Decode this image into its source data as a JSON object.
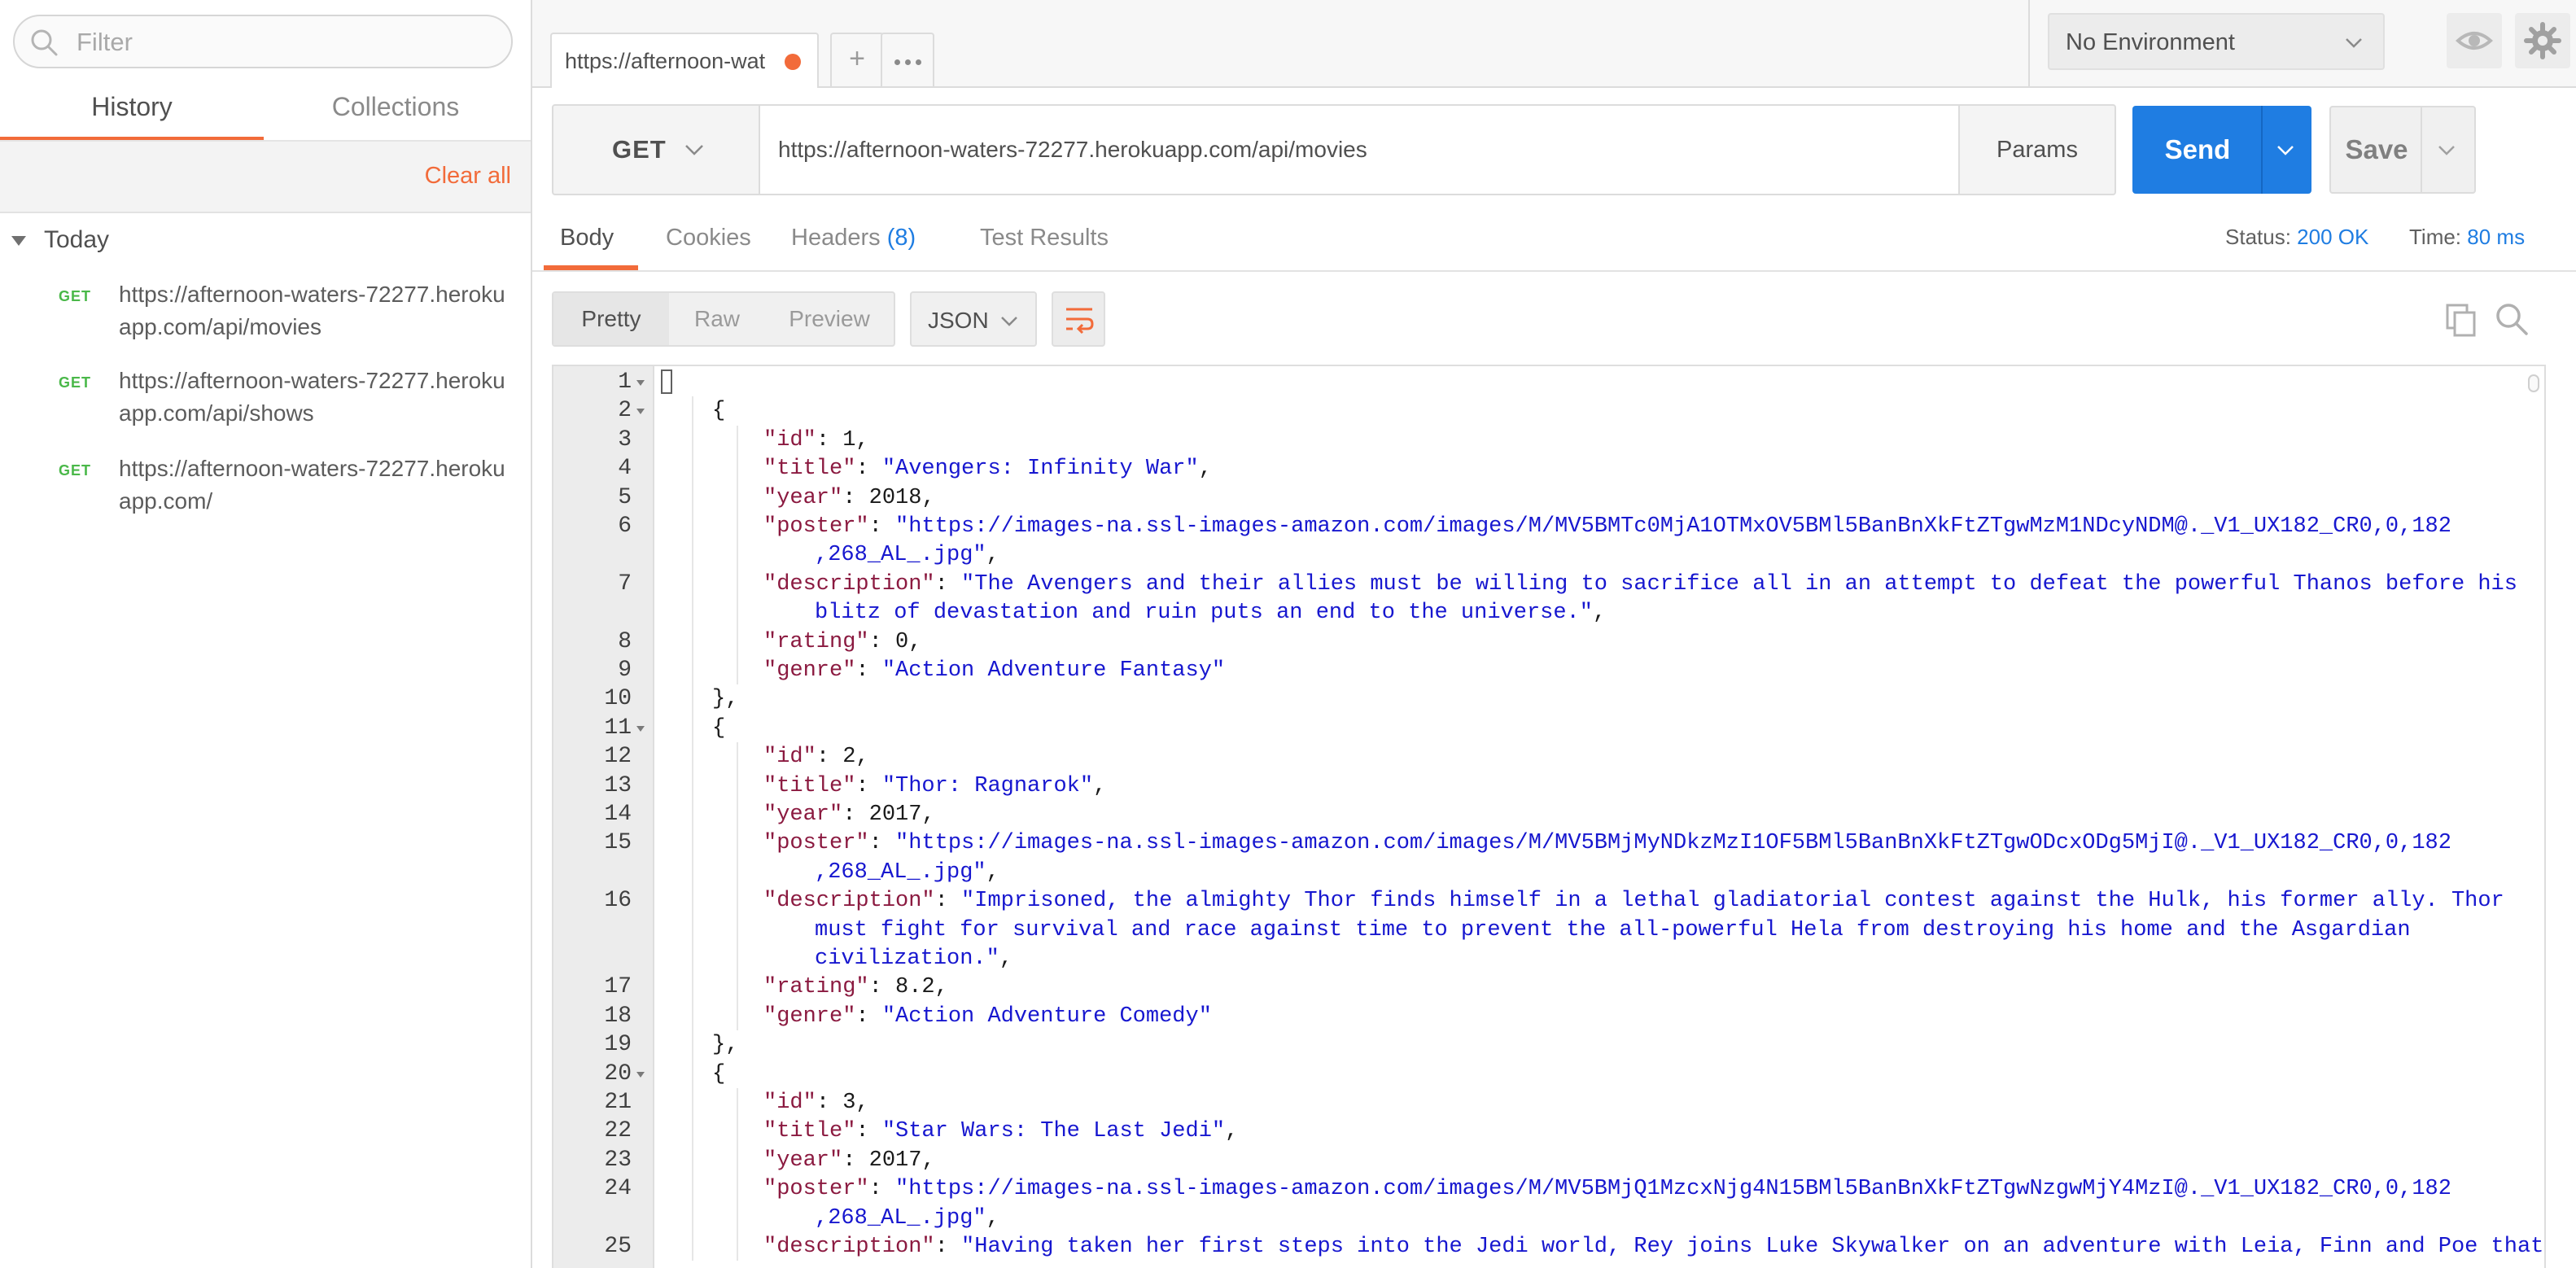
{
  "sidebar": {
    "filter_placeholder": "Filter",
    "tabs": [
      "History",
      "Collections"
    ],
    "clear_all": "Clear all",
    "group": "Today",
    "history": [
      {
        "method": "GET",
        "url": "https://afternoon-waters-72277.herokuapp.com/api/movies"
      },
      {
        "method": "GET",
        "url": "https://afternoon-waters-72277.herokuapp.com/api/shows"
      },
      {
        "method": "GET",
        "url": "https://afternoon-waters-72277.herokuapp.com/"
      }
    ]
  },
  "tabbar": {
    "active_tab": "https://afternoon-wat",
    "environment": "No Environment"
  },
  "request": {
    "method": "GET",
    "url": "https://afternoon-waters-72277.herokuapp.com/api/movies",
    "params_label": "Params",
    "send_label": "Send",
    "save_label": "Save"
  },
  "response": {
    "tabs": {
      "body": "Body",
      "cookies": "Cookies",
      "headers": "Headers",
      "headers_count": "(8)",
      "tests": "Test Results"
    },
    "status_label": "Status:",
    "status_value": "200 OK",
    "time_label": "Time:",
    "time_value": "80 ms",
    "views": [
      "Pretty",
      "Raw",
      "Preview"
    ],
    "format": "JSON"
  },
  "code": [
    {
      "n": "1",
      "fold": true,
      "indent": 0,
      "parts": [
        [
          "p",
          "["
        ]
      ]
    },
    {
      "n": "2",
      "fold": true,
      "indent": 1,
      "parts": [
        [
          "p",
          "{"
        ]
      ]
    },
    {
      "n": "3",
      "indent": 2,
      "parts": [
        [
          "k",
          "\"id\""
        ],
        [
          "p",
          ": "
        ],
        [
          "n",
          "1"
        ],
        [
          "p",
          ","
        ]
      ]
    },
    {
      "n": "4",
      "indent": 2,
      "parts": [
        [
          "k",
          "\"title\""
        ],
        [
          "p",
          ": "
        ],
        [
          "s",
          "\"Avengers: Infinity War\""
        ],
        [
          "p",
          ","
        ]
      ]
    },
    {
      "n": "5",
      "indent": 2,
      "parts": [
        [
          "k",
          "\"year\""
        ],
        [
          "p",
          ": "
        ],
        [
          "n",
          "2018"
        ],
        [
          "p",
          ","
        ]
      ]
    },
    {
      "n": "6",
      "indent": 2,
      "parts": [
        [
          "k",
          "\"poster\""
        ],
        [
          "p",
          ": "
        ],
        [
          "s",
          "\"https://images-na.ssl-images-amazon.com/images/M/MV5BMTc0MjA1OTMxOV5BMl5BanBnXkFtZTgwMzM1NDcyNDM@._V1_UX182_CR0,0,182"
        ]
      ]
    },
    {
      "n": "",
      "indent": 3,
      "parts": [
        [
          "s",
          ",268_AL_.jpg\""
        ],
        [
          "p",
          ","
        ]
      ]
    },
    {
      "n": "7",
      "indent": 2,
      "parts": [
        [
          "k",
          "\"description\""
        ],
        [
          "p",
          ": "
        ],
        [
          "s",
          "\"The Avengers and their allies must be willing to sacrifice all in an attempt to defeat the powerful Thanos before his"
        ]
      ]
    },
    {
      "n": "",
      "indent": 3,
      "parts": [
        [
          "s",
          "blitz of devastation and ruin puts an end to the universe.\""
        ],
        [
          "p",
          ","
        ]
      ]
    },
    {
      "n": "8",
      "indent": 2,
      "parts": [
        [
          "k",
          "\"rating\""
        ],
        [
          "p",
          ": "
        ],
        [
          "n",
          "0"
        ],
        [
          "p",
          ","
        ]
      ]
    },
    {
      "n": "9",
      "indent": 2,
      "parts": [
        [
          "k",
          "\"genre\""
        ],
        [
          "p",
          ": "
        ],
        [
          "s",
          "\"Action Adventure Fantasy\""
        ]
      ]
    },
    {
      "n": "10",
      "indent": 1,
      "parts": [
        [
          "p",
          "},"
        ]
      ]
    },
    {
      "n": "11",
      "fold": true,
      "indent": 1,
      "parts": [
        [
          "p",
          "{"
        ]
      ]
    },
    {
      "n": "12",
      "indent": 2,
      "parts": [
        [
          "k",
          "\"id\""
        ],
        [
          "p",
          ": "
        ],
        [
          "n",
          "2"
        ],
        [
          "p",
          ","
        ]
      ]
    },
    {
      "n": "13",
      "indent": 2,
      "parts": [
        [
          "k",
          "\"title\""
        ],
        [
          "p",
          ": "
        ],
        [
          "s",
          "\"Thor: Ragnarok\""
        ],
        [
          "p",
          ","
        ]
      ]
    },
    {
      "n": "14",
      "indent": 2,
      "parts": [
        [
          "k",
          "\"year\""
        ],
        [
          "p",
          ": "
        ],
        [
          "n",
          "2017"
        ],
        [
          "p",
          ","
        ]
      ]
    },
    {
      "n": "15",
      "indent": 2,
      "parts": [
        [
          "k",
          "\"poster\""
        ],
        [
          "p",
          ": "
        ],
        [
          "s",
          "\"https://images-na.ssl-images-amazon.com/images/M/MV5BMjMyNDkzMzI1OF5BMl5BanBnXkFtZTgwODcxODg5MjI@._V1_UX182_CR0,0,182"
        ]
      ]
    },
    {
      "n": "",
      "indent": 3,
      "parts": [
        [
          "s",
          ",268_AL_.jpg\""
        ],
        [
          "p",
          ","
        ]
      ]
    },
    {
      "n": "16",
      "indent": 2,
      "parts": [
        [
          "k",
          "\"description\""
        ],
        [
          "p",
          ": "
        ],
        [
          "s",
          "\"Imprisoned, the almighty Thor finds himself in a lethal gladiatorial contest against the Hulk, his former ally. Thor"
        ]
      ]
    },
    {
      "n": "",
      "indent": 3,
      "parts": [
        [
          "s",
          "must fight for survival and race against time to prevent the all-powerful Hela from destroying his home and the Asgardian"
        ]
      ]
    },
    {
      "n": "",
      "indent": 3,
      "parts": [
        [
          "s",
          "civilization.\""
        ],
        [
          "p",
          ","
        ]
      ]
    },
    {
      "n": "17",
      "indent": 2,
      "parts": [
        [
          "k",
          "\"rating\""
        ],
        [
          "p",
          ": "
        ],
        [
          "n",
          "8.2"
        ],
        [
          "p",
          ","
        ]
      ]
    },
    {
      "n": "18",
      "indent": 2,
      "parts": [
        [
          "k",
          "\"genre\""
        ],
        [
          "p",
          ": "
        ],
        [
          "s",
          "\"Action Adventure Comedy\""
        ]
      ]
    },
    {
      "n": "19",
      "indent": 1,
      "parts": [
        [
          "p",
          "},"
        ]
      ]
    },
    {
      "n": "20",
      "fold": true,
      "indent": 1,
      "parts": [
        [
          "p",
          "{"
        ]
      ]
    },
    {
      "n": "21",
      "indent": 2,
      "parts": [
        [
          "k",
          "\"id\""
        ],
        [
          "p",
          ": "
        ],
        [
          "n",
          "3"
        ],
        [
          "p",
          ","
        ]
      ]
    },
    {
      "n": "22",
      "indent": 2,
      "parts": [
        [
          "k",
          "\"title\""
        ],
        [
          "p",
          ": "
        ],
        [
          "s",
          "\"Star Wars: The Last Jedi\""
        ],
        [
          "p",
          ","
        ]
      ]
    },
    {
      "n": "23",
      "indent": 2,
      "parts": [
        [
          "k",
          "\"year\""
        ],
        [
          "p",
          ": "
        ],
        [
          "n",
          "2017"
        ],
        [
          "p",
          ","
        ]
      ]
    },
    {
      "n": "24",
      "indent": 2,
      "parts": [
        [
          "k",
          "\"poster\""
        ],
        [
          "p",
          ": "
        ],
        [
          "s",
          "\"https://images-na.ssl-images-amazon.com/images/M/MV5BMjQ1MzcxNjg4N15BMl5BanBnXkFtZTgwNzgwMjY4MzI@._V1_UX182_CR0,0,182"
        ]
      ]
    },
    {
      "n": "",
      "indent": 3,
      "parts": [
        [
          "s",
          ",268_AL_.jpg\""
        ],
        [
          "p",
          ","
        ]
      ]
    },
    {
      "n": "25",
      "indent": 2,
      "parts": [
        [
          "k",
          "\"description\""
        ],
        [
          "p",
          ": "
        ],
        [
          "s",
          "\"Having taken her first steps into the Jedi world, Rey joins Luke Skywalker on an adventure with Leia, Finn and Poe that"
        ]
      ]
    }
  ],
  "icons": {
    "filter": "search-icon",
    "add_tab": "plus-icon",
    "more_tabs": "ellipsis-icon",
    "env_dropdown": "chevron-down-icon",
    "eye": "eye-icon",
    "settings": "gear-icon",
    "wrap": "wrap-lines-icon",
    "copy": "copy-icon",
    "search": "search-icon"
  },
  "colors": {
    "accent": "#f26b3a",
    "primary": "#1f7de2",
    "get_method": "#4ab849",
    "json_key": "#8b1a40",
    "json_string": "#1717cf"
  }
}
